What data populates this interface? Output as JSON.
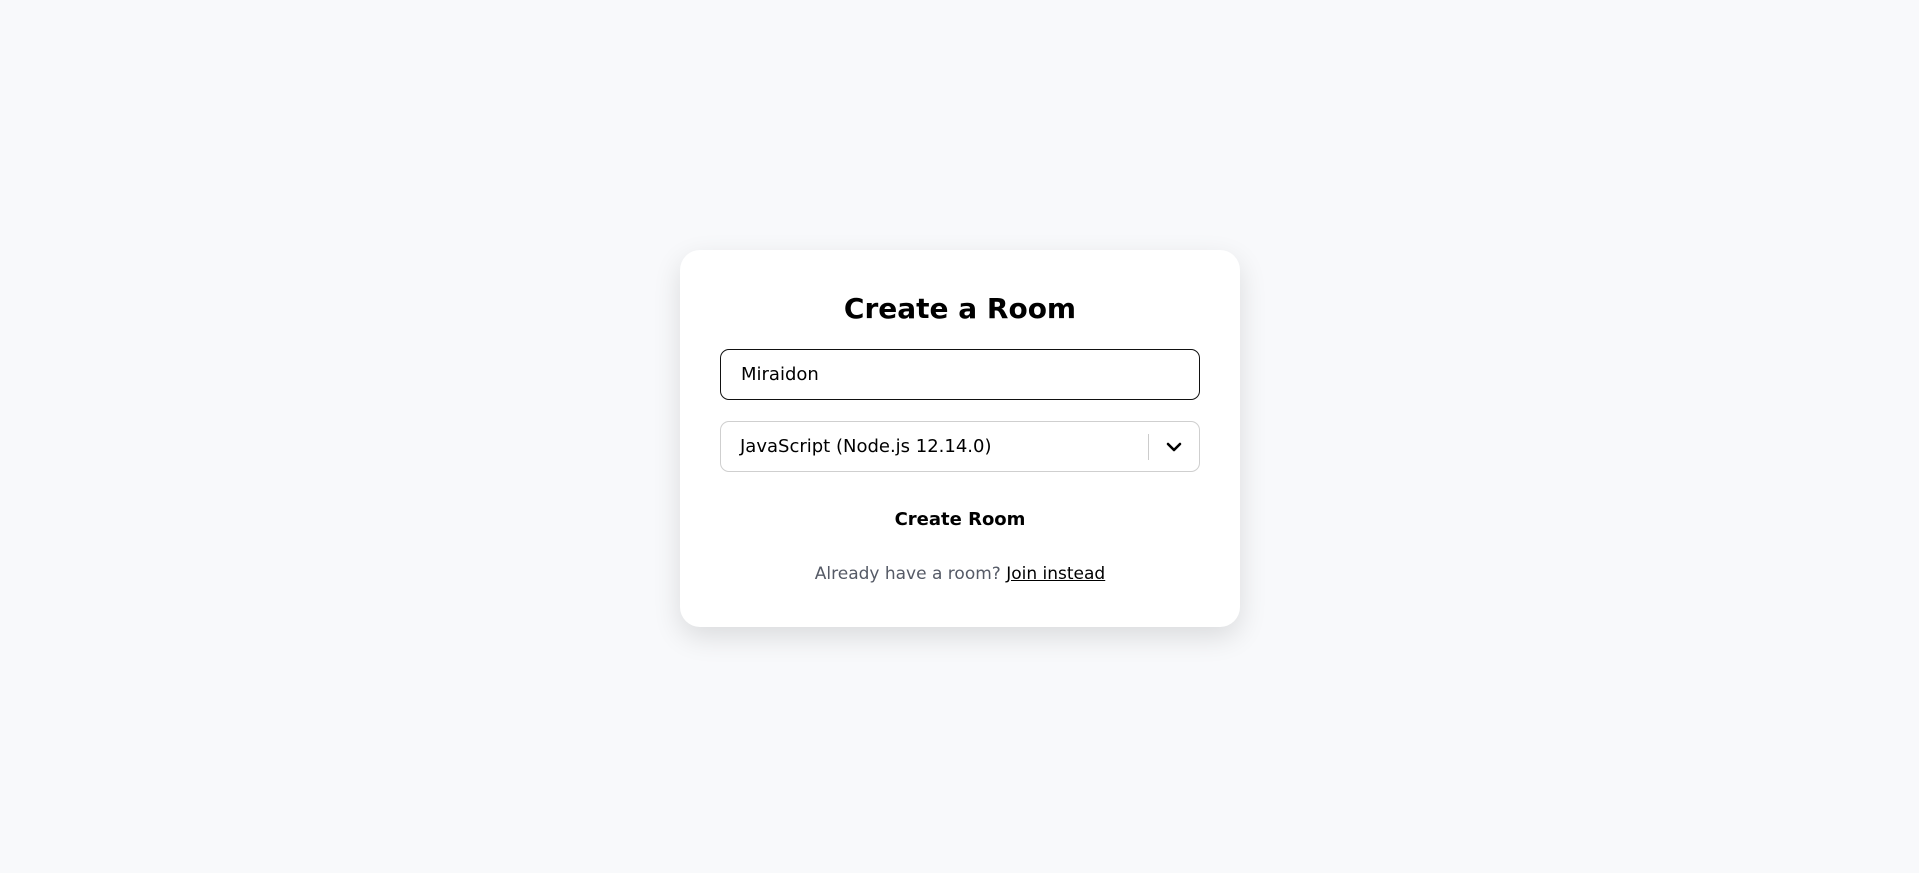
{
  "form": {
    "title": "Create a Room",
    "room_name_value": "Miraidon",
    "language_selected": "JavaScript (Node.js 12.14.0)",
    "submit_label": "Create Room",
    "footer_text": "Already have a room?",
    "join_link": "Join instead"
  }
}
